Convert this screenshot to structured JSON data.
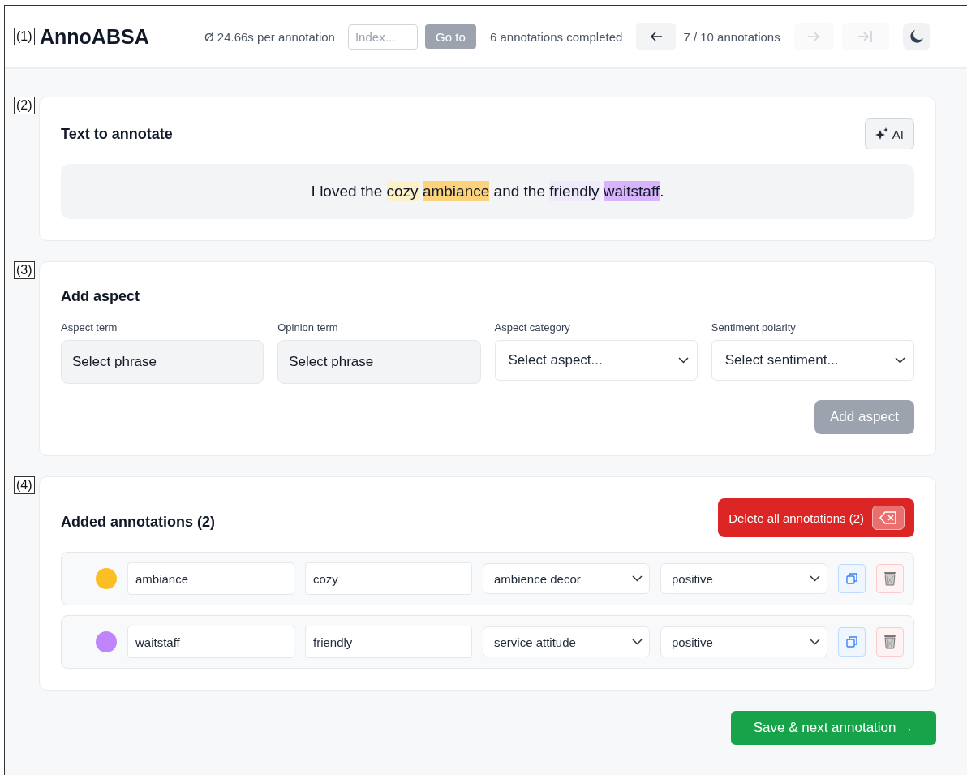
{
  "header": {
    "marker": "(1)",
    "logo": "AnnoABSA",
    "avg_time": "Ø 24.66s per annotation",
    "index_field": {
      "placeholder": "Index..."
    },
    "goto_button": {
      "label": "Go to",
      "disabled": true
    },
    "completed": "6 annotations completed",
    "prev_button": {
      "disabled": false
    },
    "position": "7 / 10 annotations",
    "next_button": {
      "disabled": true
    },
    "last_button": {
      "disabled": true
    }
  },
  "text_section": {
    "marker": "(2)",
    "title": "Text to annotate",
    "ai_button": "AI",
    "segments": [
      {
        "text": "I loved the",
        "space_after": true
      },
      {
        "text": "cozy",
        "color": "#fdf1c9",
        "space_after": true
      },
      {
        "text": "ambiance",
        "color": "#fcd27b",
        "space_after": true
      },
      {
        "text": "and the",
        "space_after": true
      },
      {
        "text": "friendly",
        "color": "#efeafb",
        "space_after": true
      },
      {
        "text": "waitstaff",
        "color": "#d8b4fe",
        "space_after": false
      },
      {
        "text": "."
      }
    ]
  },
  "add_section": {
    "marker": "(3)",
    "title": "Add aspect",
    "fields": [
      {
        "kind": "phrase",
        "label": "Aspect term",
        "value": "Select phrase"
      },
      {
        "kind": "phrase",
        "label": "Opinion term",
        "value": "Select phrase"
      },
      {
        "kind": "select",
        "label": "Aspect category",
        "value": "Select aspect..."
      },
      {
        "kind": "select",
        "label": "Sentiment polarity",
        "value": "Select sentiment..."
      }
    ],
    "add_button": {
      "label": "Add aspect",
      "disabled": true
    }
  },
  "annotations_section": {
    "marker": "(4)",
    "title": "Added annotations (2)",
    "delete_all_button": "Delete all annotations (2)",
    "rows": [
      {
        "color": "#fbbf24",
        "aspect": "ambiance",
        "opinion": "cozy",
        "category": "ambience decor",
        "polarity": "positive"
      },
      {
        "color": "#c084fc",
        "aspect": "waitstaff",
        "opinion": "friendly",
        "category": "service attitude",
        "polarity": "positive"
      }
    ]
  },
  "save_button": "Save & next annotation →"
}
